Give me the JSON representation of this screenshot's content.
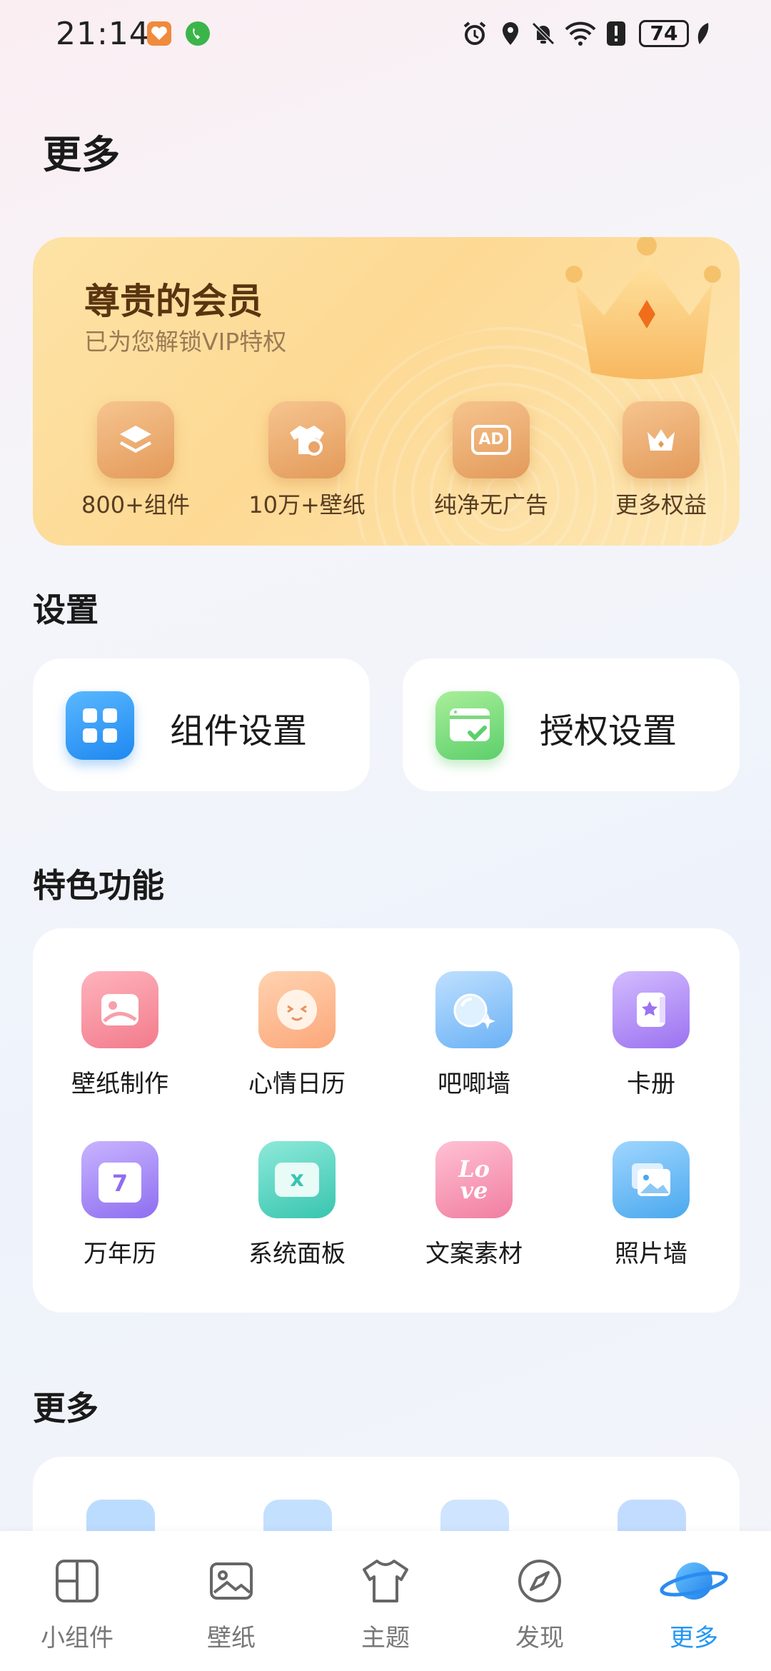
{
  "status_bar": {
    "time": "21:14",
    "battery": "74"
  },
  "page_title": "更多",
  "vip": {
    "title": "尊贵的会员",
    "subtitle": "已为您解锁VIP特权",
    "perks": [
      {
        "label": "800+组件",
        "icon": "layers-icon"
      },
      {
        "label": "10万+壁纸",
        "icon": "shirt-icon"
      },
      {
        "label": "纯净无广告",
        "icon": "ad-icon",
        "badge": "AD"
      },
      {
        "label": "更多权益",
        "icon": "crown-icon"
      }
    ]
  },
  "settings": {
    "title": "设置",
    "items": [
      {
        "label": "组件设置",
        "icon": "widget-grid-icon"
      },
      {
        "label": "授权设置",
        "icon": "authorize-check-icon"
      }
    ]
  },
  "features": {
    "title": "特色功能",
    "items": [
      {
        "label": "壁纸制作",
        "icon": "wallpaper-make-icon"
      },
      {
        "label": "心情日历",
        "icon": "mood-face-icon"
      },
      {
        "label": "吧唧墙",
        "icon": "badge-sparkle-icon"
      },
      {
        "label": "卡册",
        "icon": "card-album-icon"
      },
      {
        "label": "万年历",
        "icon": "calendar-icon",
        "num": "7"
      },
      {
        "label": "系统面板",
        "icon": "panel-icon",
        "letter": "x"
      },
      {
        "label": "文案素材",
        "icon": "love-text-icon",
        "line1": "Lo",
        "line2": "ve"
      },
      {
        "label": "照片墙",
        "icon": "photo-wall-icon"
      }
    ]
  },
  "more": {
    "title": "更多"
  },
  "bottom_nav": {
    "items": [
      {
        "label": "小组件",
        "icon": "widget-icon",
        "active": false
      },
      {
        "label": "壁纸",
        "icon": "image-icon",
        "active": false
      },
      {
        "label": "主题",
        "icon": "tshirt-icon",
        "active": false
      },
      {
        "label": "发现",
        "icon": "compass-icon",
        "active": false
      },
      {
        "label": "更多",
        "icon": "planet-icon",
        "active": true
      }
    ]
  },
  "colors": {
    "accent": "#2196f3",
    "vip_text": "#5a3410",
    "vip_bg": "#fddb9a"
  }
}
